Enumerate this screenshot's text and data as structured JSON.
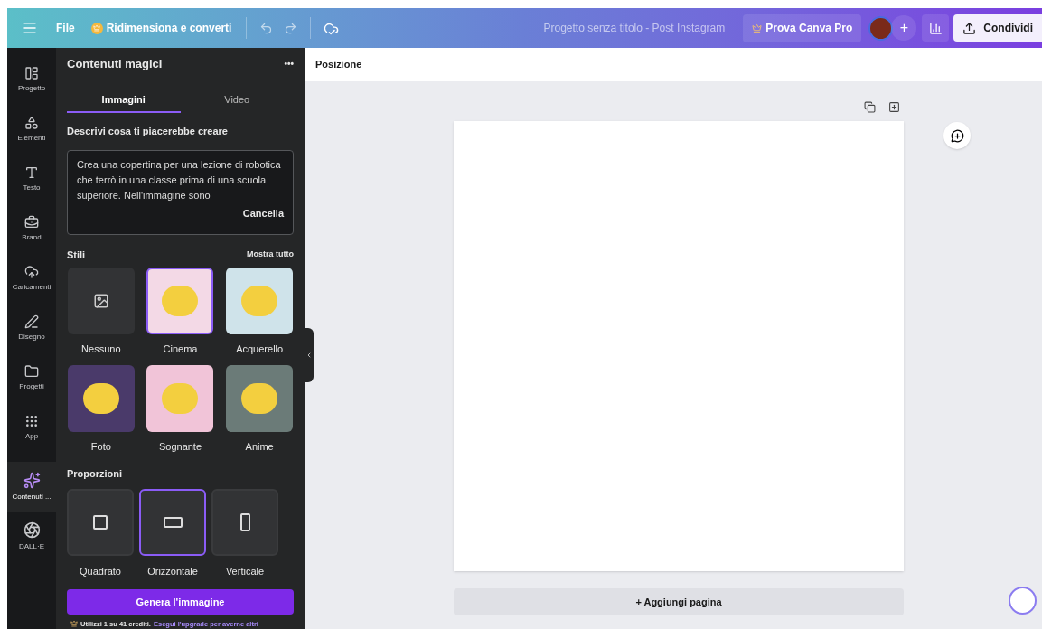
{
  "top_bar": {
    "file_label": "File",
    "resize_label": "Ridimensiona e converti",
    "project_title": "Progetto senza titolo - Post Instagram",
    "pro_button": "Prova Canva Pro",
    "share_button": "Condividi",
    "add_label": "+"
  },
  "rail": [
    {
      "label": "Progetto",
      "kind": "layout",
      "selected": false
    },
    {
      "label": "Elementi",
      "kind": "shapes",
      "selected": false
    },
    {
      "label": "Testo",
      "kind": "text",
      "selected": false
    },
    {
      "label": "Brand",
      "kind": "brand",
      "selected": false
    },
    {
      "label": "Caricamenti",
      "kind": "upload",
      "selected": false
    },
    {
      "label": "Disegno",
      "kind": "draw",
      "selected": false
    },
    {
      "label": "Progetti",
      "kind": "folder",
      "selected": false
    },
    {
      "label": "App",
      "kind": "apps",
      "selected": false
    },
    {
      "label": "Contenuti ...",
      "kind": "magic",
      "selected": true
    },
    {
      "label": "DALL·E",
      "kind": "dalle",
      "selected": false
    }
  ],
  "panel": {
    "title": "Contenuti magici",
    "more_label": "•••",
    "tabs": [
      {
        "label": "Immagini",
        "selected": true
      },
      {
        "label": "Video",
        "selected": false
      }
    ],
    "prompt_label": "Descrivi cosa ti piacerebbe creare",
    "prompt_value": "Crea una copertina per una lezione di robotica che terrò in una classe prima di una scuola superiore.  Nell'immagine sono",
    "clear_label": "Cancella",
    "styles_label": "Stili",
    "show_all": "Mostra tutto",
    "styles": [
      {
        "label": "Nessuno",
        "kind": "none",
        "selected": false
      },
      {
        "label": "Cinema",
        "kind": "image",
        "selected": true
      },
      {
        "label": "Acquerello",
        "kind": "image",
        "selected": false
      },
      {
        "label": "Foto",
        "kind": "image",
        "selected": false
      },
      {
        "label": "Sognante",
        "kind": "image",
        "selected": false
      },
      {
        "label": "Anime",
        "kind": "image",
        "selected": false
      }
    ],
    "proportions_label": "Proporzioni",
    "proportions": [
      {
        "label": "Quadrato",
        "kind": "square",
        "selected": false
      },
      {
        "label": "Orizzontale",
        "kind": "landscape",
        "selected": true
      },
      {
        "label": "Verticale",
        "kind": "portrait",
        "selected": false
      }
    ],
    "generate_button": "Genera l'immagine",
    "credits_text": "Utilizzi 1 su 41 crediti.",
    "upgrade_link": "Esegui l'upgrade per averne altri"
  },
  "canvas": {
    "toolbar_label": "Posizione",
    "add_page": "+ Aggiungi pagina"
  }
}
